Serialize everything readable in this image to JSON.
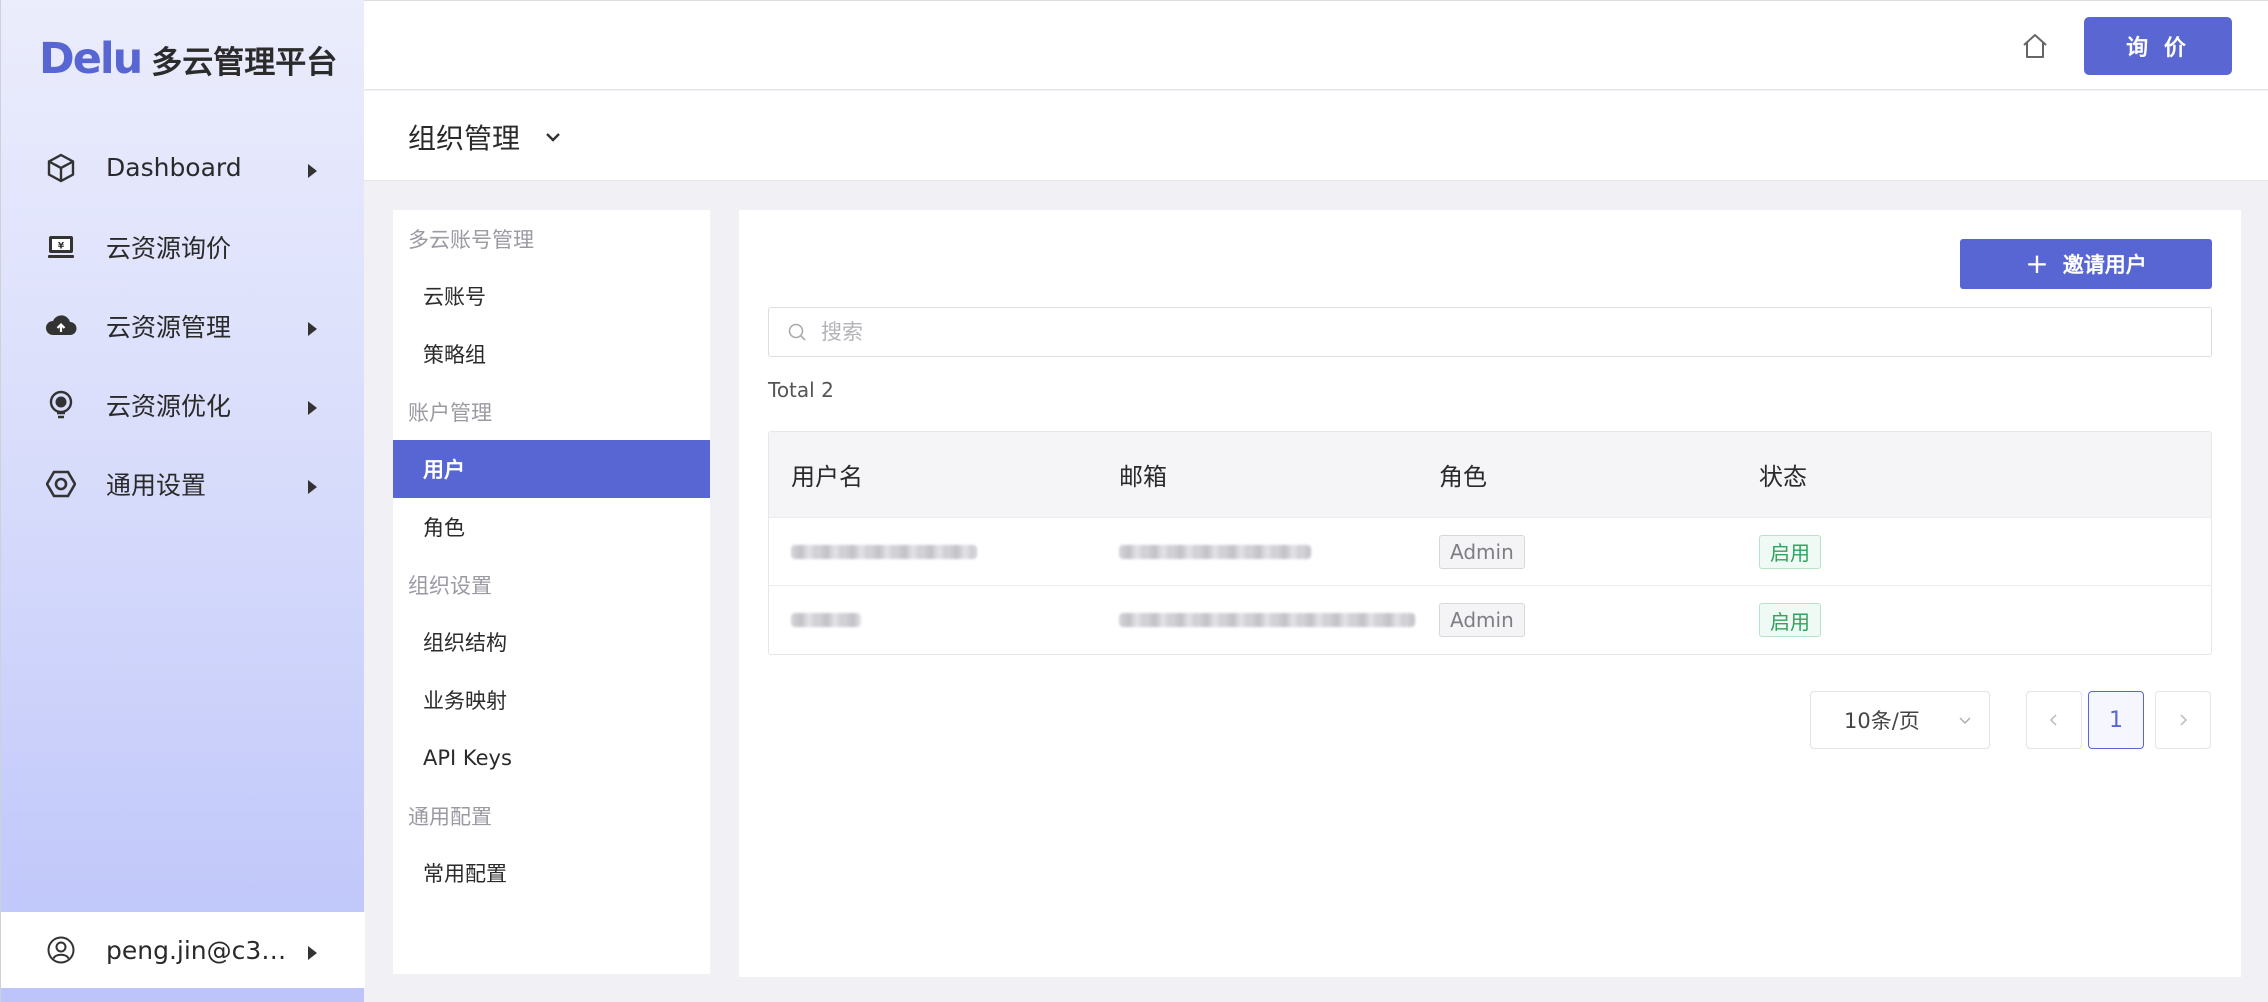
{
  "app": {
    "logo_mark": "Delu",
    "logo_text": "多云管理平台"
  },
  "sidebar": {
    "items": [
      {
        "label": "Dashboard",
        "icon": "cube-icon",
        "has_submenu": true
      },
      {
        "label": "云资源询价",
        "icon": "monitor-price-icon",
        "has_submenu": false
      },
      {
        "label": "云资源管理",
        "icon": "cloud-upload-icon",
        "has_submenu": true
      },
      {
        "label": "云资源优化",
        "icon": "bulb-icon",
        "has_submenu": true
      },
      {
        "label": "通用设置",
        "icon": "settings-hex-icon",
        "has_submenu": true
      }
    ],
    "user": {
      "label": "peng.jin@c3…",
      "icon": "user-circle-icon"
    }
  },
  "topbar": {
    "inquiry_label": "询 价",
    "home_icon": "home-icon"
  },
  "page": {
    "title": "组织管理"
  },
  "subnav": {
    "groups": [
      {
        "title": "多云账号管理",
        "items": [
          "云账号",
          "策略组"
        ]
      },
      {
        "title": "账户管理",
        "items": [
          "用户",
          "角色"
        ]
      },
      {
        "title": "组织设置",
        "items": [
          "组织结构",
          "业务映射",
          "API Keys"
        ]
      },
      {
        "title": "通用配置",
        "items": [
          "常用配置"
        ]
      }
    ],
    "active": "用户"
  },
  "main": {
    "invite_label": "邀请用户",
    "search_placeholder": "搜索",
    "total": "Total 2",
    "table": {
      "columns": [
        "用户名",
        "邮箱",
        "角色",
        "状态"
      ],
      "rows": [
        {
          "username": "[redacted]",
          "email": "[redacted]",
          "role": "Admin",
          "status": "启用"
        },
        {
          "username": "[redacted]",
          "email": "[redacted]",
          "role": "Admin",
          "status": "启用"
        }
      ]
    },
    "pagination": {
      "page_size": "10条/页",
      "current_page": "1"
    }
  },
  "colors": {
    "accent": "#5866d4",
    "status_green": "#2fa35f"
  }
}
